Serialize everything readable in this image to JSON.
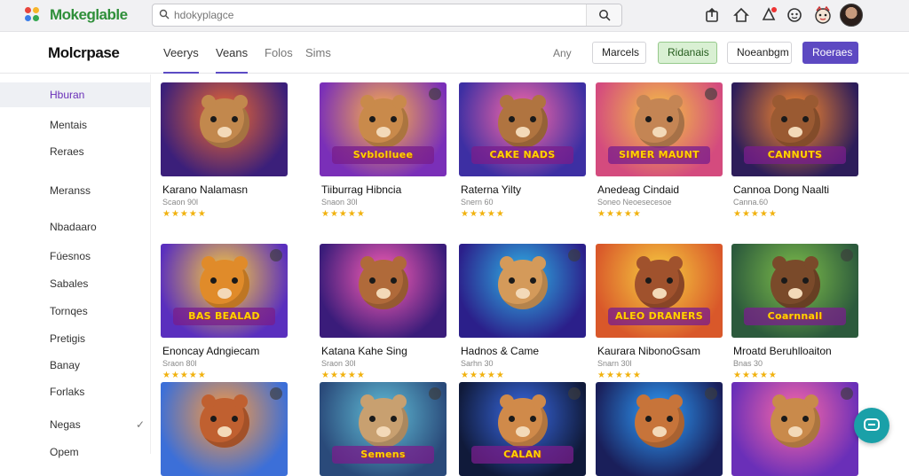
{
  "topbar": {
    "app_name": "Mokeglable",
    "search_placeholder": "hdokyplagce",
    "search_value": "",
    "icons": [
      "upload-icon",
      "home-icon",
      "notifications-icon",
      "settings-icon",
      "mascot-icon"
    ],
    "colors": {
      "accent": "#5d49c2",
      "brand_green": "#2f8f3a",
      "active_side": "#6a2fb8"
    }
  },
  "header": {
    "brand": "Molcrpase",
    "tabs": [
      {
        "label": "Veerys",
        "active": true
      },
      {
        "label": "Veans",
        "active": true
      },
      {
        "label": "Folos",
        "active": false
      },
      {
        "label": "Sims",
        "active": false
      }
    ],
    "any_label": "Any",
    "buttons": {
      "marcels": "Marcels",
      "ridanais": "Ridanais",
      "noeanbgm": "Noeanbgm",
      "roeraes": "Roeraes"
    }
  },
  "sidebar": {
    "items": [
      {
        "label": "Hburan",
        "active": true
      },
      {
        "label": "Mentais"
      },
      {
        "label": "Reraes"
      },
      {
        "label": "Meranss"
      },
      {
        "label": "Nbadaaro"
      },
      {
        "label": "Fúesnos"
      },
      {
        "label": "Sabales"
      },
      {
        "label": "Tornqes"
      },
      {
        "label": "Pretigis"
      },
      {
        "label": "Banay"
      },
      {
        "label": "Forlaks"
      },
      {
        "label": "Negas"
      },
      {
        "label": "Opem"
      }
    ],
    "check_icon": "check-icon"
  },
  "games": [
    {
      "title": "Karano Nalamasn",
      "sub": "Scaon 90l",
      "rating": "★★★★★",
      "banner": "",
      "scheme": 0
    },
    {
      "title": "Tiiburrag Hibncia",
      "sub": "Snaon 30l",
      "rating": "★★★★★",
      "banner": "Svblolluee",
      "scheme": 1
    },
    {
      "title": "Raterna Yilty",
      "sub": "Snern 60",
      "rating": "★★★★★",
      "banner": "CAKE NADS",
      "scheme": 2
    },
    {
      "title": "Anedeag Cindaid",
      "sub": "Soneo Neoesecesoe",
      "rating": "★★★★★",
      "banner": "SIMER MAUNT",
      "scheme": 3
    },
    {
      "title": "Cannoa Dong Naalti",
      "sub": "Canna.60",
      "rating": "★★★★★",
      "banner": "CANNUTS",
      "scheme": 4
    },
    {
      "title": "Enoncay Adngiecam",
      "sub": "Sraon 80l",
      "rating": "★★★★★",
      "banner": "BAS BEALAD",
      "scheme": 5
    },
    {
      "title": "Katana Kahe Sing",
      "sub": "Sraon 30l",
      "rating": "★★★★★",
      "banner": "",
      "scheme": 6
    },
    {
      "title": "Hadnos & Came",
      "sub": "Sarhn 30",
      "rating": "★★★★★",
      "banner": "",
      "scheme": 7
    },
    {
      "title": "Kaurara NibonoGsam",
      "sub": "Snarn 30l",
      "rating": "★★★★★",
      "banner": "ALEO DRANERS",
      "scheme": 8
    },
    {
      "title": "Mroatd Beruhlloaiton",
      "sub": "Bnas 30",
      "rating": "★★★★★",
      "banner": "Coarnnall",
      "scheme": 9
    },
    {
      "title": "",
      "sub": "",
      "rating": "",
      "banner": "",
      "scheme": 10
    },
    {
      "title": "",
      "sub": "",
      "rating": "",
      "banner": "Semens",
      "scheme": 11
    },
    {
      "title": "",
      "sub": "",
      "rating": "",
      "banner": "CALAN",
      "scheme": 12
    },
    {
      "title": "",
      "sub": "",
      "rating": "",
      "banner": "",
      "scheme": 13
    },
    {
      "title": "",
      "sub": "",
      "rating": "",
      "banner": "",
      "scheme": 14
    }
  ],
  "chat_button_icon": "chat-icon"
}
